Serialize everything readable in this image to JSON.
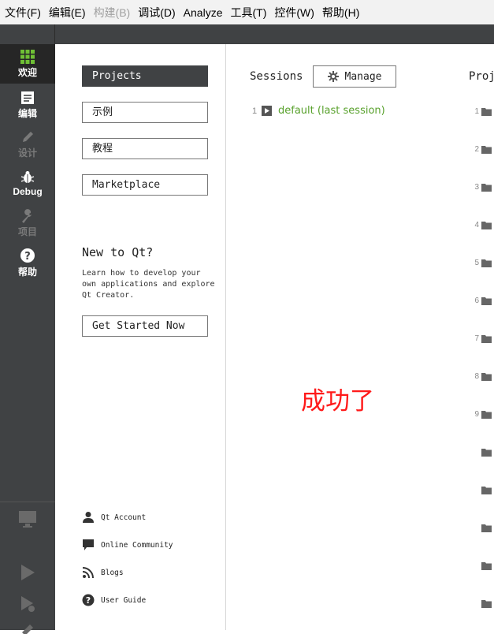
{
  "menubar": {
    "items": [
      {
        "label": "文件(F)",
        "enabled": true
      },
      {
        "label": "编辑(E)",
        "enabled": true
      },
      {
        "label": "构建(B)",
        "enabled": false
      },
      {
        "label": "调试(D)",
        "enabled": true
      },
      {
        "label": "Analyze",
        "enabled": true
      },
      {
        "label": "工具(T)",
        "enabled": true
      },
      {
        "label": "控件(W)",
        "enabled": true
      },
      {
        "label": "帮助(H)",
        "enabled": true
      }
    ]
  },
  "sidebar": {
    "modes": [
      {
        "label": "欢迎",
        "icon": "grid-icon",
        "active": true
      },
      {
        "label": "编辑",
        "icon": "document-icon"
      },
      {
        "label": "设计",
        "icon": "pencil-icon",
        "disabled": true
      },
      {
        "label": "Debug",
        "icon": "bug-icon"
      },
      {
        "label": "项目",
        "icon": "wrench-icon",
        "disabled": true
      },
      {
        "label": "帮助",
        "icon": "question-icon"
      }
    ]
  },
  "left": {
    "buttons": {
      "projects": "Projects",
      "examples": "示例",
      "tutorials": "教程",
      "marketplace": "Marketplace"
    },
    "new_to_qt": "New to Qt?",
    "learn_text": "Learn how to develop your own applications and explore Qt Creator.",
    "get_started": "Get Started Now",
    "links": {
      "account": "Qt Account",
      "community": "Online Community",
      "blogs": "Blogs",
      "guide": "User Guide"
    }
  },
  "sessions": {
    "title": "Sessions",
    "manage_label": "Manage",
    "items": [
      {
        "num": "1",
        "name": "default (last session)"
      }
    ]
  },
  "projects": {
    "title": "Proj",
    "numbers": [
      "1",
      "2",
      "3",
      "4",
      "5",
      "6",
      "7",
      "8",
      "9",
      "",
      "",
      "",
      "",
      ""
    ]
  },
  "overlay_text": "成功了",
  "colors": {
    "sidebar_bg": "#404244",
    "active_mode_bg": "#262626",
    "session_link": "#58a12c",
    "overlay_text": "#ff1a1a",
    "grid_icon": "#6fbf35"
  }
}
